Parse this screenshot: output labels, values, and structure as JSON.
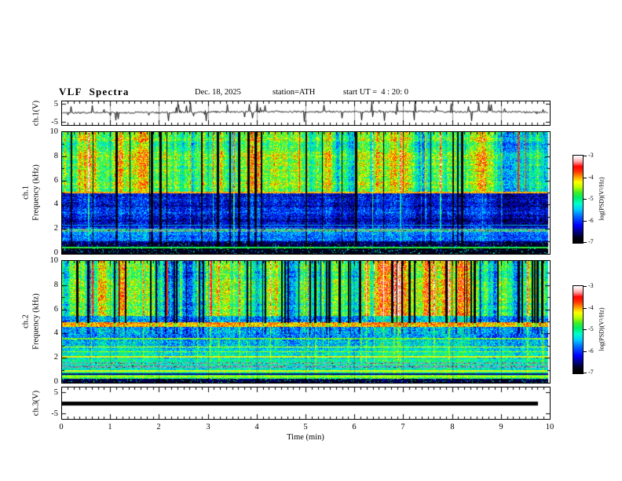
{
  "header": {
    "title": "VLF Spectra",
    "date": "Dec. 18, 2025",
    "station": "station=ATH",
    "start_ut": "start UT =  4 : 20: 0"
  },
  "xaxis": {
    "label": "Time (min)",
    "min": 0,
    "max": 10,
    "ticks": [
      "0",
      "1",
      "2",
      "3",
      "4",
      "5",
      "6",
      "7",
      "8",
      "9",
      "10"
    ],
    "minor_per_major": 8
  },
  "panels": {
    "wave1": {
      "ylabel": "ch.1(V)",
      "ytick_top": "5",
      "ytick_bottom": "-5"
    },
    "spec1": {
      "channel": "ch.1",
      "axis": "Frequency (kHz)",
      "yticks": [
        "10",
        "8",
        "6",
        "4",
        "2",
        "0"
      ]
    },
    "spec2": {
      "channel": "ch.2",
      "axis": "Frequency (kHz)",
      "yticks": [
        "10",
        "8",
        "6",
        "4",
        "2",
        "0"
      ]
    },
    "wave3": {
      "ylabel": "ch.3(V)",
      "ytick_top": "5",
      "ytick_bottom": "-5"
    }
  },
  "colorbar": {
    "label": "log(PSD)(V²/Hz)",
    "ticks": [
      "-3",
      "-4",
      "-5",
      "-6",
      "-7"
    ]
  },
  "colormap": {
    "zlim": [
      -7,
      -3
    ],
    "stops": [
      {
        "pos": 0.0,
        "color": "#000000"
      },
      {
        "pos": 0.06,
        "color": "#00001a"
      },
      {
        "pos": 0.12,
        "color": "#000080"
      },
      {
        "pos": 0.2,
        "color": "#0000ff"
      },
      {
        "pos": 0.3,
        "color": "#0066ff"
      },
      {
        "pos": 0.38,
        "color": "#00ccff"
      },
      {
        "pos": 0.45,
        "color": "#00ffcc"
      },
      {
        "pos": 0.52,
        "color": "#00ee66"
      },
      {
        "pos": 0.58,
        "color": "#44ee22"
      },
      {
        "pos": 0.64,
        "color": "#bbff00"
      },
      {
        "pos": 0.7,
        "color": "#ffff00"
      },
      {
        "pos": 0.76,
        "color": "#ff9900"
      },
      {
        "pos": 0.82,
        "color": "#ff3300"
      },
      {
        "pos": 0.88,
        "color": "#ff0000"
      },
      {
        "pos": 0.93,
        "color": "#ff9999"
      },
      {
        "pos": 0.97,
        "color": "#ffdddd"
      },
      {
        "pos": 1.0,
        "color": "#ffffff"
      }
    ]
  },
  "chart_data": [
    {
      "type": "line",
      "name": "ch1-waveform",
      "ylabel": "ch.1(V)",
      "xlim": [
        0,
        10
      ],
      "ylim": [
        -6.2,
        6.2
      ],
      "yticks": [
        5,
        -5
      ],
      "baseline_v": 0.3,
      "noise_v": 0.45,
      "spike_prob": 0.07,
      "spike_vmax": 5.5,
      "data_end_min": 9.95,
      "seed": 42,
      "description": "Noisy channel-1 voltage trace near 0 V with many impulsive sferic spikes reaching about +/-5 V; faint vertical graticule lines at each minute"
    },
    {
      "type": "heatmap",
      "name": "ch1-spectrogram",
      "ylabel": "ch.1 Frequency (kHz)",
      "xlim": [
        0,
        10
      ],
      "ylim": [
        0,
        10
      ],
      "zlabel": "log(PSD)(V²/Hz)",
      "zlim": [
        -7,
        -3
      ],
      "seed": 1234,
      "bands": [
        {
          "fmin": 5.0,
          "fmax": 10.0,
          "base": -4.75,
          "noise": 0.55,
          "streak": 1.3,
          "bright": 1.2
        },
        {
          "fmin": 2.2,
          "fmax": 5.0,
          "base": -6.15,
          "noise": 0.55,
          "streak": 0.45,
          "bright": 0.9
        },
        {
          "fmin": 1.0,
          "fmax": 2.2,
          "base": -5.8,
          "noise": 0.5,
          "streak": 0.3,
          "bright": 0.5
        },
        {
          "fmin": 0.45,
          "fmax": 1.0,
          "base": -6.5,
          "noise": 0.45,
          "streak": 0.2,
          "bright": 0.4,
          "speckle_p": 0.05,
          "speckle_v": -5.4
        },
        {
          "fmin": 0.0,
          "fmax": 0.45,
          "base": -6.9,
          "noise": 0.4,
          "streak": 0.1,
          "bright": 0.3,
          "speckle_p": 0.07,
          "speckle_v": -5.2
        }
      ],
      "hlines": [
        {
          "f": 5.02,
          "hw": 0.07,
          "v": -4.0
        },
        {
          "f": 1.93,
          "hw": 0.12,
          "v": -5.1,
          "gray": 0.55
        },
        {
          "f": 2.35,
          "hw": 0.05,
          "v": -5.6
        },
        {
          "f": 0.52,
          "hw": 0.06,
          "v": -4.8
        }
      ],
      "dark_col_prob": 0.03,
      "dark_hard_fmin": 5.0,
      "dark_soft_fmin": 0.6,
      "dark_soft_amount": 1.0,
      "bright_col_prob": 0.045,
      "hot_col_prob": 0.01,
      "hot_v": -3.6,
      "hot_fmin": 5.0,
      "description": "Green/yellow broadband sferic streaks above 5 kHz with scattered black dropout columns; blue low-PSD region 2-5 kHz; grayish band near 2 kHz; near-black band below 0.5 kHz"
    },
    {
      "type": "heatmap",
      "name": "ch2-spectrogram",
      "ylabel": "ch.2 Frequency (kHz)",
      "xlim": [
        0,
        10
      ],
      "ylim": [
        0,
        10
      ],
      "zlabel": "log(PSD)(V²/Hz)",
      "zlim": [
        -7,
        -3
      ],
      "seed": 777,
      "bands": [
        {
          "fmin": 5.5,
          "fmax": 10.0,
          "base": -4.85,
          "noise": 0.55,
          "streak": 1.5,
          "bright": 1.0
        },
        {
          "fmin": 4.95,
          "fmax": 5.5,
          "base": -5.6,
          "noise": 0.6,
          "streak": 0.6,
          "bright": 0.6
        },
        {
          "fmin": 4.55,
          "fmax": 4.95,
          "base": -3.95,
          "noise": 0.45,
          "streak": 0.25,
          "bright": 0.3
        },
        {
          "fmin": 3.0,
          "fmax": 4.55,
          "base": -5.55,
          "noise": 0.6,
          "streak": 0.4,
          "bright": 0.6
        },
        {
          "fmin": 2.0,
          "fmax": 3.0,
          "base": -5.3,
          "noise": 0.5,
          "streak": 0.3,
          "bright": 0.45
        },
        {
          "fmin": 0.35,
          "fmax": 2.0,
          "base": -4.95,
          "noise": 0.5,
          "streak": 0.2,
          "bright": 0.35
        },
        {
          "fmin": 0.0,
          "fmax": 0.35,
          "base": -6.75,
          "noise": 0.4,
          "streak": 0.1,
          "bright": 0.2,
          "speckle_p": 0.07,
          "speckle_v": -5.0
        }
      ],
      "hlines": [
        {
          "f": 2.12,
          "hw": 0.06,
          "v": -4.25
        },
        {
          "f": 2.55,
          "hw": 0.05,
          "v": -4.5
        },
        {
          "f": 2.95,
          "hw": 0.05,
          "v": -4.35
        },
        {
          "f": 3.62,
          "hw": 0.05,
          "v": -4.6
        },
        {
          "f": 1.3,
          "hw": 0.1,
          "v": -5.4,
          "gray": 0.6
        },
        {
          "f": 1.62,
          "hw": 0.08,
          "v": -5.3,
          "gray": 0.6
        },
        {
          "f": 0.98,
          "hw": 0.05,
          "v": -4.3
        },
        {
          "f": 0.72,
          "hw": 0.06,
          "v": -6.5
        },
        {
          "f": 0.5,
          "hw": 0.05,
          "v": -4.45
        }
      ],
      "dark_col_prob": 0.085,
      "dark_hard_fmin": 4.9,
      "dark_soft_fmin": 4.0,
      "dark_soft_amount": 0.6,
      "bright_col_prob": 0.035,
      "hot_col_prob": 0.007,
      "hot_v": -3.6,
      "hot_fmin": 5.5,
      "description": "Dense dark-blue/black vertical stripes above 5.5 kHz on green background; red horizontal PSD band near 4.7 kHz; cyan/green speckle below with yellow power-line harmonics near 1, 2.1, 2.5, 3 kHz and gray dashed bands near 1.3-1.7 kHz"
    },
    {
      "type": "line",
      "name": "ch3-waveform",
      "ylabel": "ch.3(V)",
      "xlim": [
        0,
        10
      ],
      "ylim": [
        -6.8,
        6.8
      ],
      "yticks": [
        5,
        -5
      ],
      "baseline_v": 0,
      "flat": true,
      "bar_thickness_px": 5,
      "data_end_min": 9.75,
      "description": "Channel 3 is flat: a thick solid black line at 0 V ending near 9.75 min"
    }
  ]
}
